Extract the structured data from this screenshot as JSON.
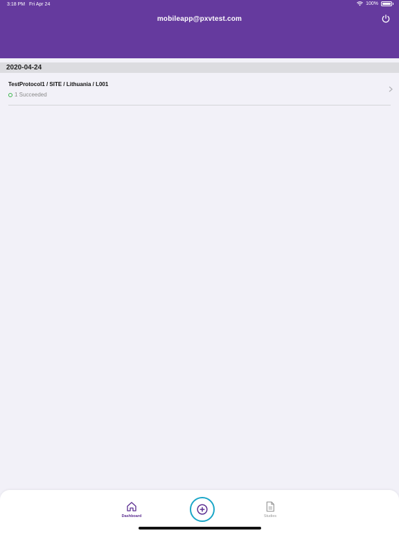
{
  "status_bar": {
    "time": "3:18 PM",
    "date": "Fri Apr 24",
    "battery": "100%",
    "icons": [
      "wifi-icon",
      "battery-icon"
    ]
  },
  "header": {
    "title": "mobileapp@pxvtest.com",
    "power_icon": "power-icon"
  },
  "groups": [
    {
      "date": "2020-04-24",
      "items": [
        {
          "title": "TestProtocol1 / SITE / Lithuania / L001",
          "status": "1 Succeeded",
          "status_color": "#39b54a"
        }
      ]
    }
  ],
  "tabbar": {
    "dashboard_label": "Dashboard",
    "studies_label": "Studies",
    "active_color": "#5c2f91",
    "inactive_color": "#9a9a9a",
    "add_button_color": "#1aa6c7"
  },
  "colors": {
    "header_bg": "#653a9e",
    "page_bg": "#f2f1f8"
  }
}
